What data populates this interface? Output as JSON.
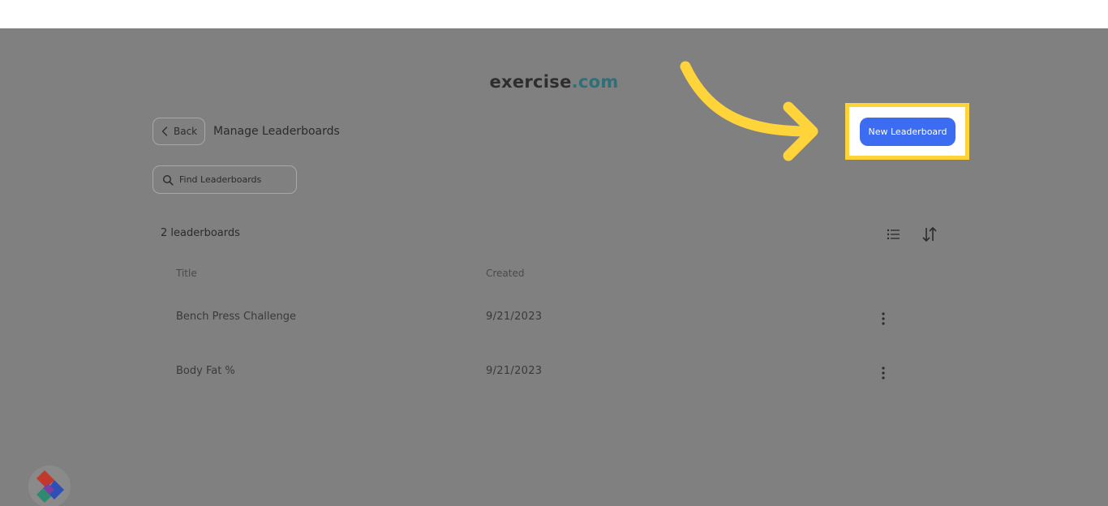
{
  "brand": {
    "name": "exercise",
    "suffix": ".com"
  },
  "header": {
    "back_label": "Back",
    "title": "Manage Leaderboards",
    "new_button_label": "New Leaderboard"
  },
  "search": {
    "placeholder": "Find Leaderboards",
    "value": ""
  },
  "list": {
    "count_label": "2 leaderboards",
    "columns": {
      "title": "Title",
      "created": "Created"
    },
    "rows": [
      {
        "title": "Bench Press Challenge",
        "created": "9/21/2023"
      },
      {
        "title": "Body Fat %",
        "created": "9/21/2023"
      }
    ]
  },
  "icons": {
    "back": "chevron-left-icon",
    "search": "search-icon",
    "list_view": "list-icon",
    "sort": "sort-icon",
    "row_menu": "more-vertical-icon",
    "guide_arrow": "curved-arrow-icon",
    "widget": "assistant-logo-icon"
  },
  "colors": {
    "overlay": "#808080",
    "primary_button": "#3b6cf2",
    "highlight": "#ffd43b",
    "brand_accent": "#2f6f78"
  }
}
